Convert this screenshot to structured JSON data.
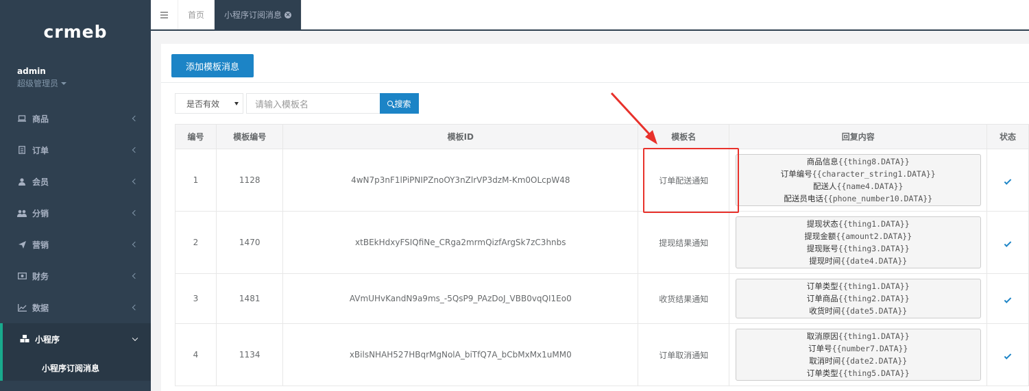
{
  "sidebar": {
    "logo": "crmeb",
    "user": {
      "name": "admin",
      "role": "超级管理员"
    },
    "items": [
      {
        "label": "商品",
        "icon": "laptop-icon"
      },
      {
        "label": "订单",
        "icon": "clipboard-icon"
      },
      {
        "label": "会员",
        "icon": "user-icon"
      },
      {
        "label": "分销",
        "icon": "users-icon"
      },
      {
        "label": "营销",
        "icon": "send-icon"
      },
      {
        "label": "财务",
        "icon": "money-icon"
      },
      {
        "label": "数据",
        "icon": "line-chart-icon"
      },
      {
        "label": "小程序",
        "icon": "cubes-icon"
      }
    ],
    "sub_item": "小程序订阅消息"
  },
  "tabs": {
    "home": "首页",
    "current": "小程序订阅消息"
  },
  "toolbar": {
    "add_button": "添加模板消息",
    "select_value": "是否有效",
    "search_placeholder": "请输入模板名",
    "search_button": "搜索"
  },
  "table": {
    "headers": [
      "编号",
      "模板编号",
      "模板ID",
      "模板名",
      "回复内容",
      "状态"
    ],
    "rows": [
      {
        "id": "1",
        "tempkey": "1128",
        "tempid": "4wN7p3nF1lPiPNIPZnoOY3nZlrVP3dzM-Km0OLcpW48",
        "name": "订单配送通知",
        "content": [
          {
            "label": "商品信息",
            "ph": "{{thing8.DATA}}"
          },
          {
            "label": "订单编号",
            "ph": "{{character_string1.DATA}}"
          },
          {
            "label": "配送人",
            "ph": "{{name4.DATA}}"
          },
          {
            "label": "配送员电话",
            "ph": "{{phone_number10.DATA}}"
          }
        ]
      },
      {
        "id": "2",
        "tempkey": "1470",
        "tempid": "xtBEkHdxyFSIQfiNe_CRga2mrmQizfArgSk7zC3hnbs",
        "name": "提现结果通知",
        "content": [
          {
            "label": "提现状态",
            "ph": "{{thing1.DATA}}"
          },
          {
            "label": "提现金额",
            "ph": "{{amount2.DATA}}"
          },
          {
            "label": "提现账号",
            "ph": "{{thing3.DATA}}"
          },
          {
            "label": "提现时间",
            "ph": "{{date4.DATA}}"
          }
        ]
      },
      {
        "id": "3",
        "tempkey": "1481",
        "tempid": "AVmUHvKandN9a9ms_-5QsP9_PAzDoJ_VBB0vqQI1Eo0",
        "name": "收货结果通知",
        "content": [
          {
            "label": "订单类型",
            "ph": "{{thing1.DATA}}"
          },
          {
            "label": "订单商品",
            "ph": "{{thing2.DATA}}"
          },
          {
            "label": "收货时间",
            "ph": "{{date5.DATA}}"
          }
        ]
      },
      {
        "id": "4",
        "tempkey": "1134",
        "tempid": "xBilsNHAH527HBqrMgNolA_biTfQ7A_bCbMxMx1uMM0",
        "name": "订单取消通知",
        "content": [
          {
            "label": "取消原因",
            "ph": "{{thing1.DATA}}"
          },
          {
            "label": "订单号",
            "ph": "{{number7.DATA}}"
          },
          {
            "label": "取消时间",
            "ph": "{{date2.DATA}}"
          },
          {
            "label": "订单类型",
            "ph": "{{thing5.DATA}}"
          }
        ]
      }
    ]
  },
  "colors": {
    "sidebar": "#2f4050",
    "primary": "#1c84c6",
    "highlight": "#e8312b"
  }
}
